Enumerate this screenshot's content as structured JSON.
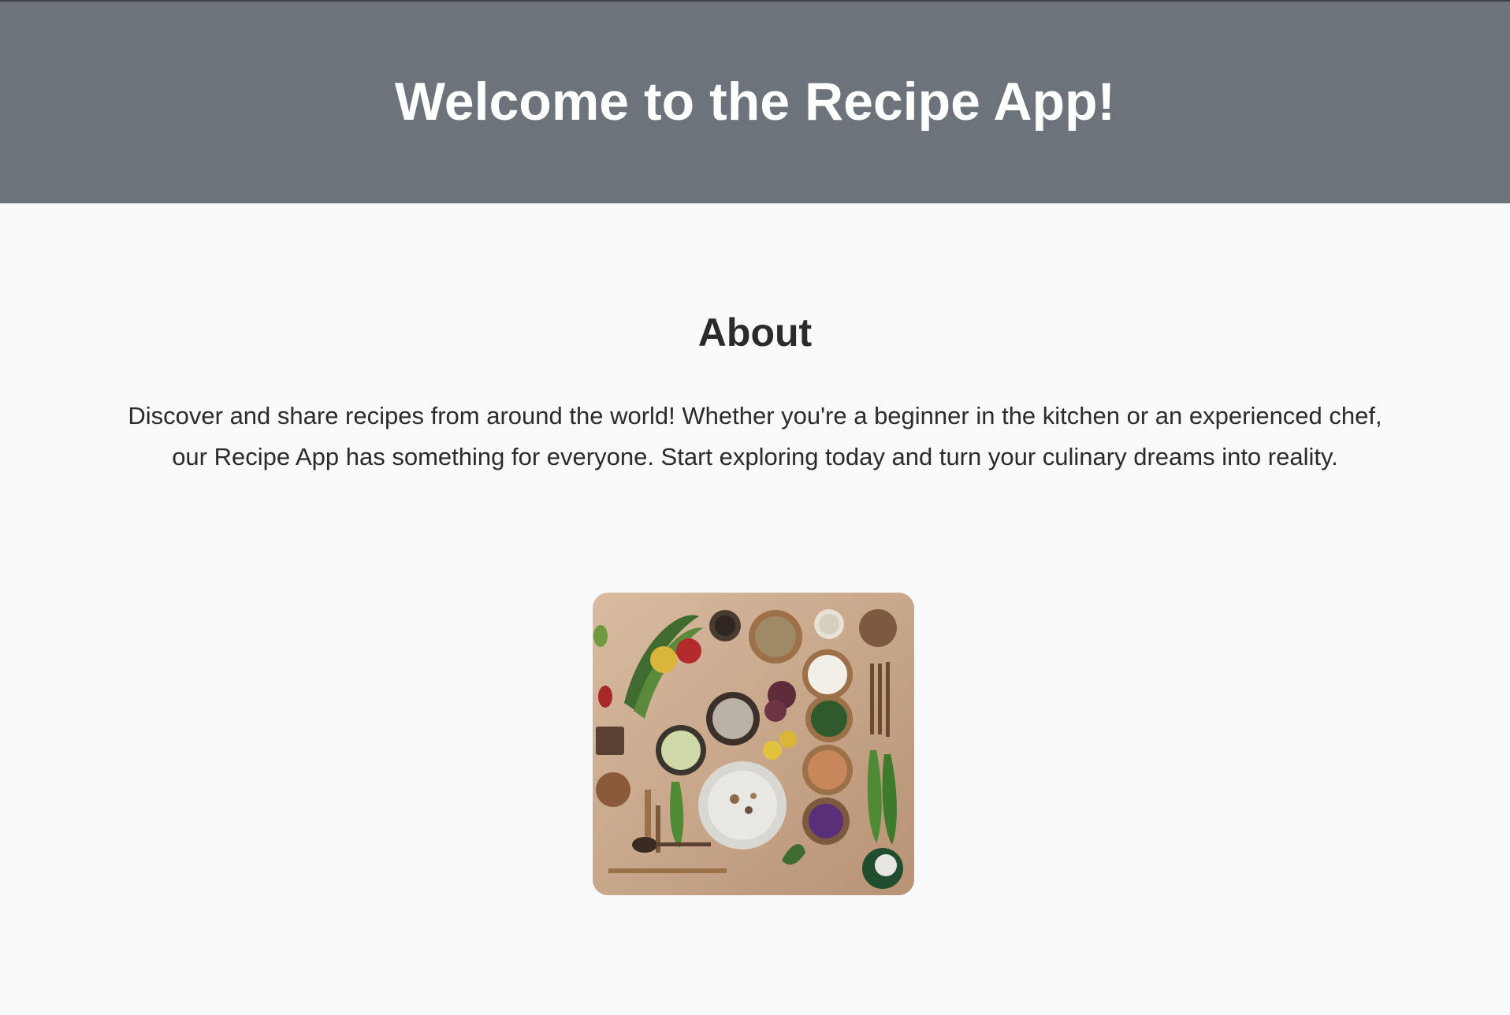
{
  "header": {
    "title": "Welcome to the Recipe App!"
  },
  "about": {
    "heading": "About",
    "text": "Discover and share recipes from around the world! Whether you're a beginner in the kitchen or an experienced chef, our Recipe App has something for everyone. Start exploring today and turn your culinary dreams into reality."
  },
  "image": {
    "icon": "food-ingredients-flatlay"
  },
  "colors": {
    "header_bg": "#6c737b",
    "page_bg": "#f8f9fa",
    "text": "#2b2b2b"
  }
}
